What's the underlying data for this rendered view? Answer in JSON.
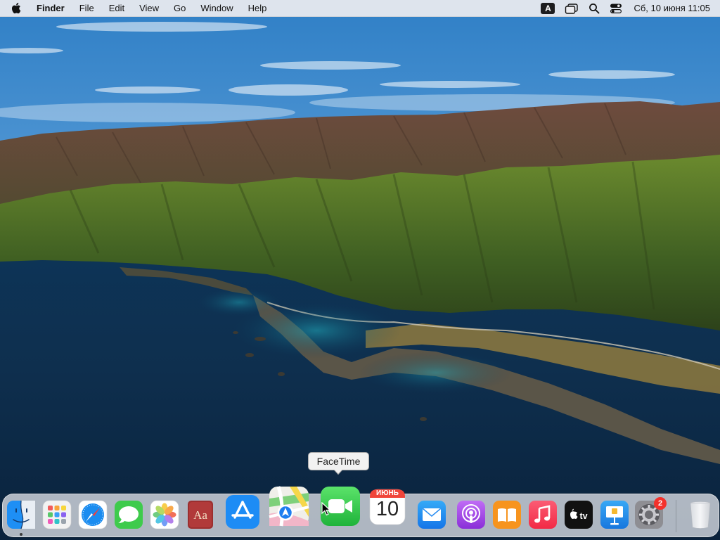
{
  "menubar": {
    "app_name": "Finder",
    "menus": [
      "File",
      "Edit",
      "View",
      "Go",
      "Window",
      "Help"
    ],
    "status": {
      "input_source": "A",
      "clock": "Сб, 10 июня  11:05"
    }
  },
  "dock": {
    "apps": [
      {
        "name": "Finder",
        "icon": "finder-icon",
        "running": true
      },
      {
        "name": "Launchpad",
        "icon": "launchpad-icon"
      },
      {
        "name": "Safari",
        "icon": "safari-icon"
      },
      {
        "name": "Messages",
        "icon": "messages-icon"
      },
      {
        "name": "Photos",
        "icon": "photos-icon"
      },
      {
        "name": "Dictionary",
        "icon": "dictionary-icon",
        "glyph": "Aa"
      },
      {
        "name": "App Store",
        "icon": "app-store-icon"
      },
      {
        "name": "Maps",
        "icon": "maps-icon"
      },
      {
        "name": "FaceTime",
        "icon": "facetime-icon"
      },
      {
        "name": "Calendar",
        "icon": "calendar-icon",
        "month": "ИЮНЬ",
        "day": "10"
      },
      {
        "name": "Mail",
        "icon": "mail-icon"
      },
      {
        "name": "Podcasts",
        "icon": "podcasts-icon"
      },
      {
        "name": "Books",
        "icon": "books-icon"
      },
      {
        "name": "Music",
        "icon": "music-icon"
      },
      {
        "name": "TV",
        "icon": "tv-icon",
        "glyph": "tv"
      },
      {
        "name": "Keynote",
        "icon": "keynote-icon"
      },
      {
        "name": "System Preferences",
        "icon": "system-preferences-icon",
        "badge": "2"
      },
      {
        "name": "Trash",
        "icon": "trash-icon"
      }
    ]
  },
  "tooltip": {
    "text": "FaceTime"
  },
  "colors": {
    "menubar_bg": "#ececf0",
    "badge_red": "#f3322c",
    "facetime_green": "#34c759"
  }
}
